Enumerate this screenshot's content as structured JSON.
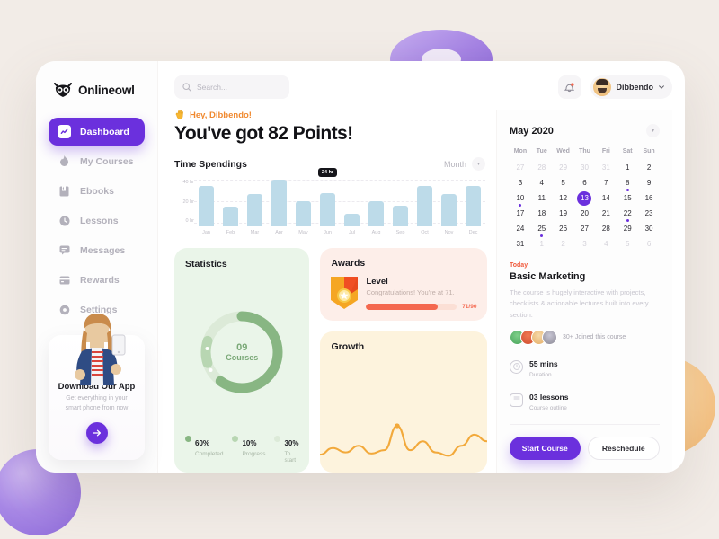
{
  "brand": {
    "name": "Onlineowl",
    "logo_icon": "owl-icon"
  },
  "sidebar": {
    "items": [
      {
        "label": "Dashboard",
        "icon": "chart-square-icon",
        "active": true
      },
      {
        "label": "My Courses",
        "icon": "fire-icon",
        "active": false
      },
      {
        "label": "Ebooks",
        "icon": "book-icon",
        "active": false
      },
      {
        "label": "Lessons",
        "icon": "clock-icon",
        "active": false
      },
      {
        "label": "Messages",
        "icon": "chat-icon",
        "active": false
      },
      {
        "label": "Rewards",
        "icon": "card-icon",
        "active": false
      },
      {
        "label": "Settings",
        "icon": "gear-icon",
        "active": false
      }
    ],
    "promo": {
      "title": "Download Our App",
      "subtitle": "Get everything in your smart phone from now",
      "button_icon": "arrow-right-icon"
    }
  },
  "topbar": {
    "search_placeholder": "Search...",
    "search_value": "",
    "search_icon": "search-icon",
    "bell_icon": "bell-icon",
    "profile_name": "Dibbendo",
    "chevron_icon": "chevron-down-icon"
  },
  "hero": {
    "greeting": "Hey, Dibbendo!",
    "greeting_icon": "waving-hand-icon",
    "headline": "You've got 82 Points!"
  },
  "chart_data": {
    "type": "bar",
    "title": "Time Spendings",
    "categories": [
      "Jan",
      "Feb",
      "Mar",
      "Apr",
      "May",
      "Jun",
      "Jul",
      "Aug",
      "Sep",
      "Oct",
      "Nov",
      "Dec"
    ],
    "values": [
      29,
      14,
      23,
      35,
      18,
      24,
      9,
      18,
      15,
      29,
      23,
      29
    ],
    "ylim": [
      0,
      40
    ],
    "yticks": [
      "0 hr",
      "20 hr",
      "40 hr"
    ],
    "ylabel": "",
    "xlabel": "",
    "grid": true,
    "bar_color": "#bddbe9",
    "tooltip": {
      "index": 5,
      "text": "24 hr"
    },
    "range_selector": "Month"
  },
  "statistics": {
    "title": "Statistics",
    "center_number": "09",
    "center_label": "Courses",
    "segments": [
      {
        "value": "60%",
        "label": "Completed",
        "color": "#88b683"
      },
      {
        "value": "10%",
        "label": "Progress",
        "color": "#b8d6b2"
      },
      {
        "value": "30%",
        "label": "To start",
        "color": "#dcead8"
      }
    ]
  },
  "awards": {
    "title": "Awards",
    "badge_icon": "medal-icon",
    "level_title": "Level",
    "level_message": "Congratulations! You're at 71.",
    "progress_text": "71/90",
    "progress_percent": 79,
    "accent": "#f4684f"
  },
  "growth": {
    "title": "Growth",
    "line_color": "#f2a93b",
    "points": [
      8,
      14,
      10,
      16,
      9,
      12,
      34,
      12,
      20,
      10,
      7,
      16,
      26,
      20
    ]
  },
  "calendar": {
    "month_label": "May 2020",
    "chevron_icon": "chevron-down-icon",
    "weekdays": [
      "Mon",
      "Tue",
      "Wed",
      "Thu",
      "Fri",
      "Sat",
      "Sun"
    ],
    "weeks": [
      [
        {
          "d": "27",
          "mute": true
        },
        {
          "d": "28",
          "mute": true
        },
        {
          "d": "29",
          "mute": true
        },
        {
          "d": "30",
          "mute": true
        },
        {
          "d": "31",
          "mute": true
        },
        {
          "d": "1"
        },
        {
          "d": "2"
        }
      ],
      [
        {
          "d": "3"
        },
        {
          "d": "4"
        },
        {
          "d": "5"
        },
        {
          "d": "6"
        },
        {
          "d": "7"
        },
        {
          "d": "8",
          "mark": true
        },
        {
          "d": "9"
        }
      ],
      [
        {
          "d": "10",
          "mark": true
        },
        {
          "d": "11"
        },
        {
          "d": "12"
        },
        {
          "d": "13",
          "sel": true
        },
        {
          "d": "14"
        },
        {
          "d": "15"
        },
        {
          "d": "16"
        }
      ],
      [
        {
          "d": "17"
        },
        {
          "d": "18"
        },
        {
          "d": "19"
        },
        {
          "d": "20"
        },
        {
          "d": "21"
        },
        {
          "d": "22",
          "mark": true
        },
        {
          "d": "23"
        }
      ],
      [
        {
          "d": "24"
        },
        {
          "d": "25",
          "mark": true
        },
        {
          "d": "26"
        },
        {
          "d": "27"
        },
        {
          "d": "28"
        },
        {
          "d": "29"
        },
        {
          "d": "30"
        }
      ],
      [
        {
          "d": "31"
        },
        {
          "d": "1",
          "mute": true
        },
        {
          "d": "2",
          "mute": true
        },
        {
          "d": "3",
          "mute": true
        },
        {
          "d": "4",
          "mute": true
        },
        {
          "d": "5",
          "mute": true
        },
        {
          "d": "6",
          "mute": true
        }
      ]
    ]
  },
  "course": {
    "today_label": "Today",
    "title": "Basic Marketing",
    "description": "The course is hugely interactive with projects, checklists & actionable lectures built into every section.",
    "joined_text": "30+ Joined this course",
    "meta": [
      {
        "icon": "clock-icon",
        "value": "55 mins",
        "label": "Duration"
      },
      {
        "icon": "book-icon",
        "value": "03 lessons",
        "label": "Course outline"
      }
    ],
    "primary_button": "Start Course",
    "secondary_button": "Reschedule"
  }
}
